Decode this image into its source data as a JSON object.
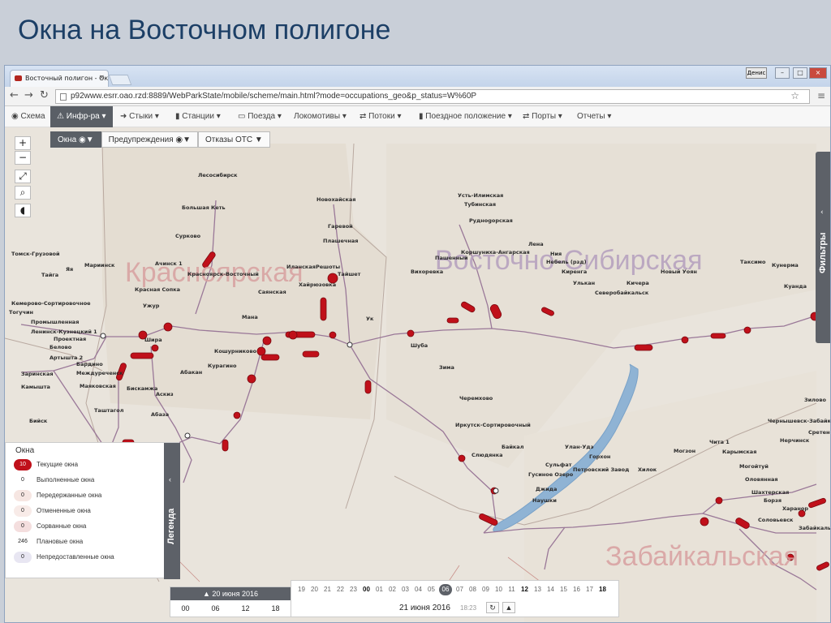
{
  "slide": {
    "title": "Окна на Восточном полигоне"
  },
  "browser": {
    "tab_title": "Восточный полигон - Ок",
    "tab_close": "×",
    "user_badge": "Денис",
    "win_minimize": "–",
    "win_maximize": "□",
    "win_close": "×",
    "url": "p92www.esrr.oao.rzd:8889/WebParkState/mobile/scheme/main.html?mode=occupations_geo&p_status=W%60P"
  },
  "appnav": {
    "items": [
      {
        "label": "Схема",
        "icon": "globe-icon"
      },
      {
        "label": "Инфр-ра ▾",
        "icon": "warning-icon",
        "active": true
      },
      {
        "label": "Стыки ▾",
        "icon": "arrow-right-icon"
      },
      {
        "label": "Станции ▾",
        "icon": "bars-icon"
      },
      {
        "label": "Поезда ▾",
        "icon": "train-icon"
      },
      {
        "label": "Локомотивы ▾",
        "icon": ""
      },
      {
        "label": "Потоки ▾",
        "icon": "shuffle-icon"
      },
      {
        "label": "Поездное положение ▾",
        "icon": "bars-icon"
      },
      {
        "label": "Порты ▾",
        "icon": "shuffle-icon"
      },
      {
        "label": "Отчеты ▾",
        "icon": ""
      }
    ]
  },
  "subtabs": [
    {
      "label": "Окна",
      "active": true
    },
    {
      "label": "Предупреждения",
      "active": false
    },
    {
      "label": "Отказы ОТС",
      "active": false
    }
  ],
  "map_controls": {
    "zoom_in": "+",
    "zoom_out": "−",
    "filters_label": "Фильтры",
    "filters_arrow": "‹"
  },
  "regions": [
    {
      "label": "Красноярская"
    },
    {
      "label": "Восточно-Сибирская"
    },
    {
      "label": "Забайкальская"
    }
  ],
  "stations": [
    "Лесосибирск",
    "Большая Кеть",
    "Новохайская",
    "Гаревой",
    "Сурково",
    "Томск-Грузовой",
    "Мариинск",
    "Тайга",
    "Яя",
    "Ачинск 1",
    "Красноярск-Восточный",
    "Иланская",
    "Решоты",
    "Тайшет",
    "Плашечная",
    "Хайрюзовка",
    "Саянская",
    "Красная Сопка",
    "Ужур",
    "Кемерово-Сортировочное",
    "Тогучин",
    "Промышленная",
    "Ленинск-Кузнецкий 1",
    "Проектная",
    "Белово",
    "Артышта 2",
    "Бардино",
    "Заринская",
    "Междуреченск",
    "Абакан",
    "Курагино",
    "Кошурниково",
    "Мана",
    "Маяковская",
    "Ширa",
    "Бискамжа",
    "Аскиз",
    "Абаза",
    "Таштагол",
    "Бийск",
    "Камышта",
    "Усть-Илимская",
    "Тубинская",
    "Руднogорская",
    "Коршуниха-Ангарская",
    "Пашенный",
    "Вихоревка",
    "Лена",
    "Ния",
    "Небель (рзд)",
    "Киренга",
    "Улькан",
    "Северобайкальск",
    "Кичера",
    "Новый Уоян",
    "Кунерма",
    "Таксимо",
    "Куанда",
    "Ук",
    "Шуба",
    "Зима",
    "Черемхово",
    "Иркутск-Сортировочный",
    "Байкал",
    "Слюдянка",
    "Улан-Удэ",
    "Горхон",
    "Петровский Завод",
    "Хилок",
    "Могзон",
    "Сульфат",
    "Гусиное Озеро",
    "Джида",
    "Наушки",
    "Чита 1",
    "Карымская",
    "Могойтуй",
    "Оловянная",
    "Шахтерская",
    "Борзя",
    "Харанор",
    "Соловьевск",
    "Забайкальск",
    "Чернышевск-Забайкальский",
    "Нерчинск",
    "Сретенск",
    "Зилово"
  ],
  "legend": {
    "title": "Окна",
    "tab_label": "Легенда",
    "tab_arrow": "‹",
    "rows": [
      {
        "count": "10",
        "label": "Текущие окна",
        "color": "#c0101a"
      },
      {
        "count": "0",
        "label": "Выполненные окна",
        "color": "#ffffff"
      },
      {
        "count": "0",
        "label": "Передержанные окна",
        "color": "#f6e6e2"
      },
      {
        "count": "0",
        "label": "Отмененные окна",
        "color": "#f8ebe8"
      },
      {
        "count": "0",
        "label": "Сорванные окна",
        "color": "#f4dede"
      },
      {
        "count": "246",
        "label": "Плановые окна",
        "color": "#ffffff"
      },
      {
        "count": "0",
        "label": "Непредоставленные окна",
        "color": "#e8e6f2"
      }
    ]
  },
  "date_panel": {
    "header": "▲ 20 июня 2016",
    "hours": [
      "00",
      "06",
      "12",
      "18"
    ]
  },
  "timeline": {
    "hours": [
      {
        "h": "19"
      },
      {
        "h": "20"
      },
      {
        "h": "21"
      },
      {
        "h": "22"
      },
      {
        "h": "23"
      },
      {
        "h": "00",
        "bold": true
      },
      {
        "h": "01"
      },
      {
        "h": "02"
      },
      {
        "h": "03"
      },
      {
        "h": "04"
      },
      {
        "h": "05"
      },
      {
        "h": "06",
        "current": true
      },
      {
        "h": "07"
      },
      {
        "h": "08"
      },
      {
        "h": "09"
      },
      {
        "h": "10"
      },
      {
        "h": "11"
      },
      {
        "h": "12",
        "bold": true
      },
      {
        "h": "13"
      },
      {
        "h": "14"
      },
      {
        "h": "15"
      },
      {
        "h": "16"
      },
      {
        "h": "17"
      },
      {
        "h": "18",
        "bold": true
      }
    ],
    "day": "21 июня 2016",
    "time": "18:23",
    "refresh": "↻",
    "up": "▲"
  }
}
